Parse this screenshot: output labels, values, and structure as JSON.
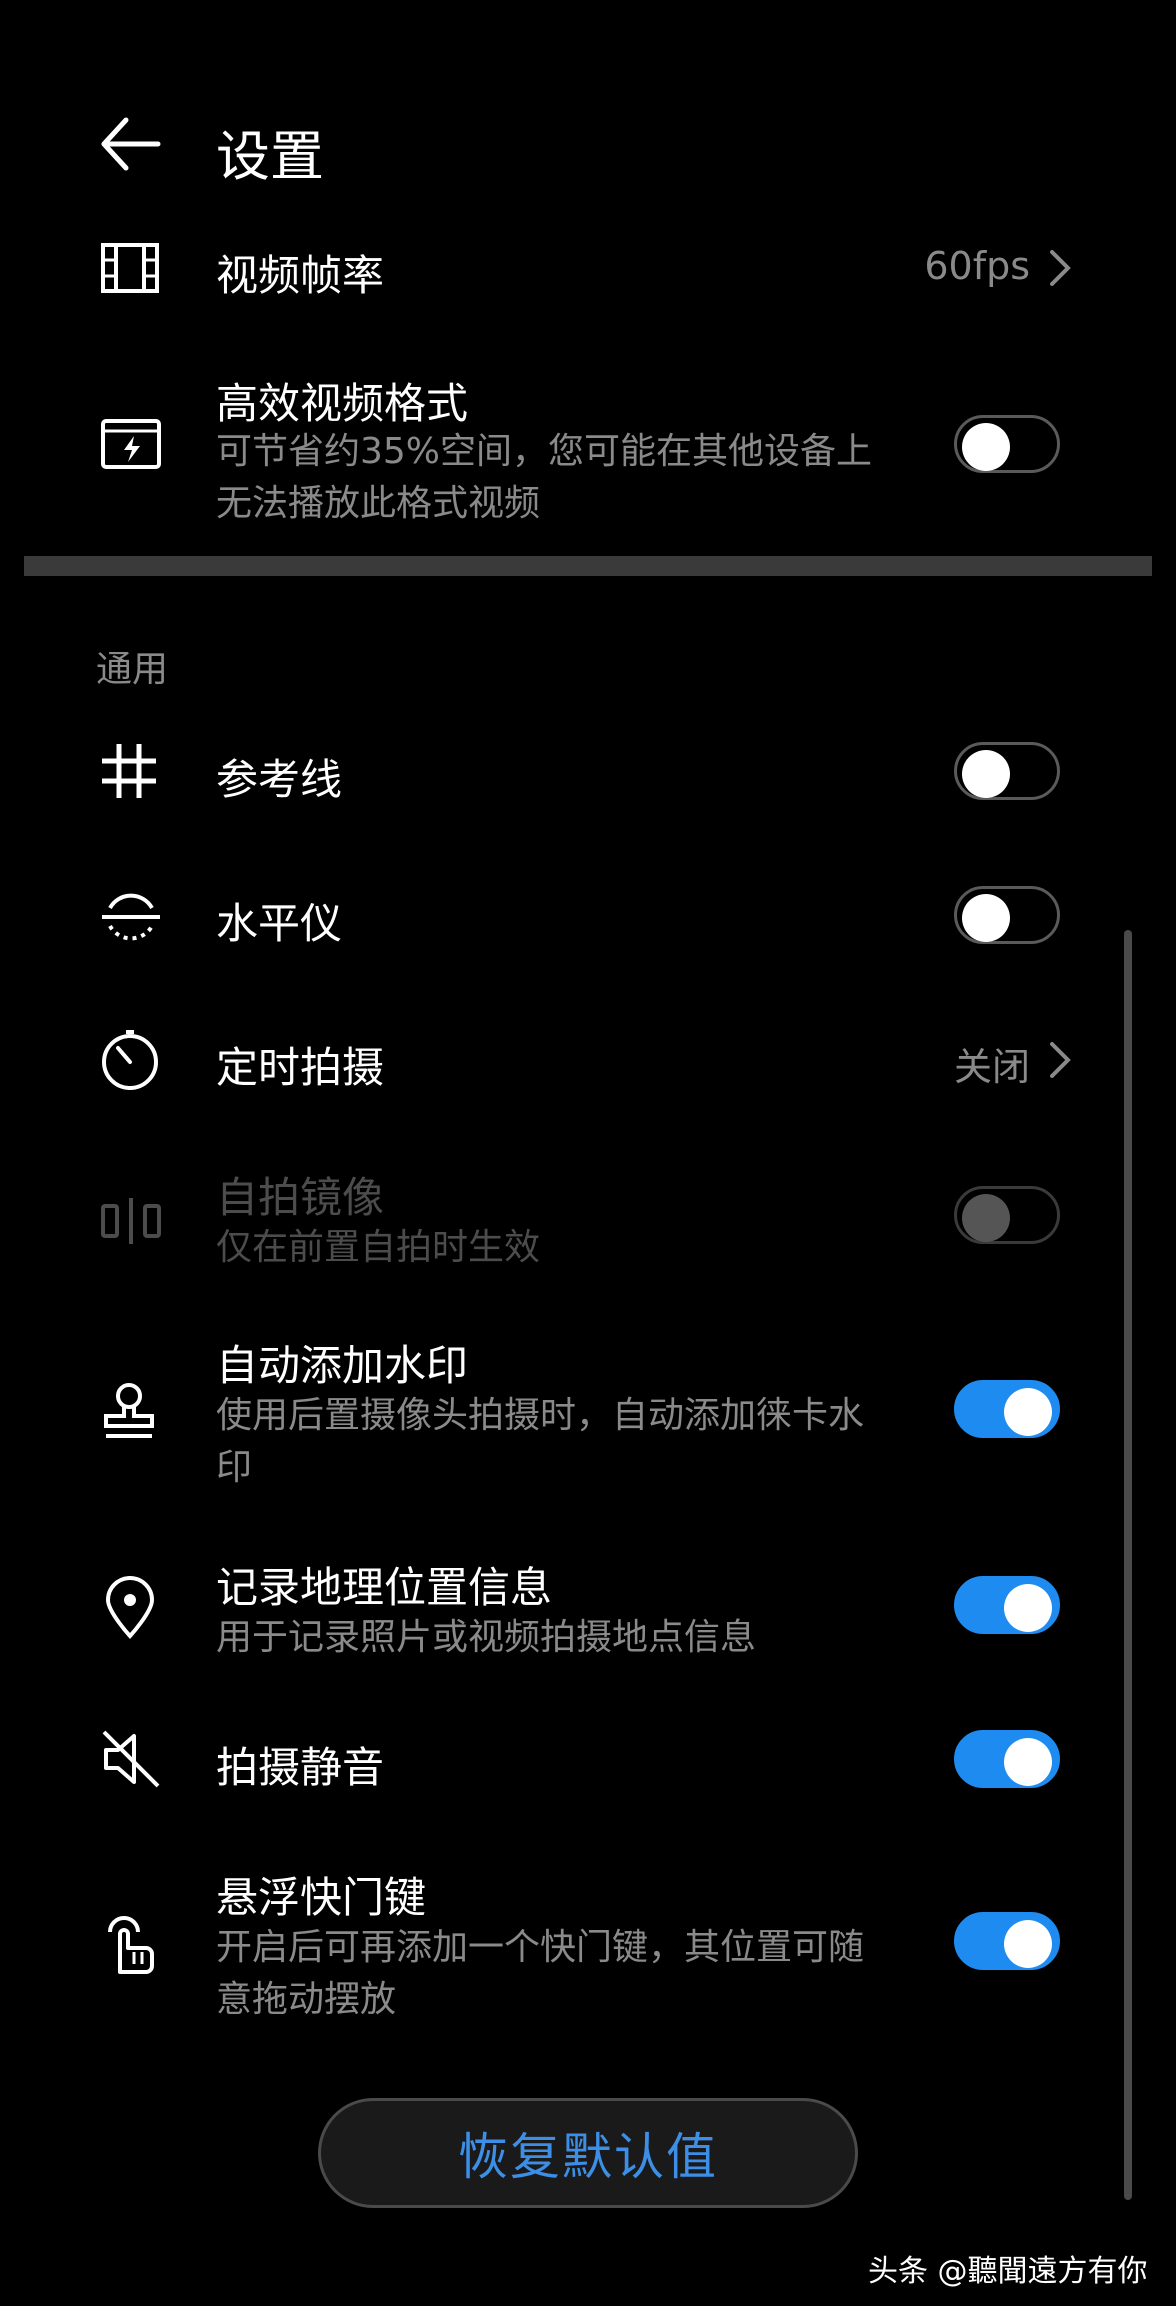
{
  "header": {
    "title": "设置"
  },
  "video_fps": {
    "label": "视频帧率",
    "value": "60fps"
  },
  "efficient_format": {
    "label": "高效视频格式",
    "subtitle": "可节省约35%空间，您可能在其他设备上无法播放此格式视频",
    "enabled": false
  },
  "section_general": {
    "label": "通用"
  },
  "grid": {
    "label": "参考线",
    "enabled": false
  },
  "level": {
    "label": "水平仪",
    "enabled": false
  },
  "timer": {
    "label": "定时拍摄",
    "value": "关闭"
  },
  "mirror": {
    "label": "自拍镜像",
    "subtitle": "仅在前置自拍时生效",
    "enabled": false,
    "disabled": true
  },
  "watermark": {
    "label": "自动添加水印",
    "subtitle": "使用后置摄像头拍摄时，自动添加徕卡水印",
    "enabled": true
  },
  "location": {
    "label": "记录地理位置信息",
    "subtitle": "用于记录照片或视频拍摄地点信息",
    "enabled": true
  },
  "mute": {
    "label": "拍摄静音",
    "enabled": true
  },
  "floating_shutter": {
    "label": "悬浮快门键",
    "subtitle": "开启后可再添加一个快门键，其位置可随意拖动摆放",
    "enabled": true
  },
  "reset_button": {
    "label": "恢复默认值"
  },
  "corner_watermark": {
    "text": "头条 @聽聞遠方有你"
  },
  "colors": {
    "accent": "#1e8bf0",
    "background": "#000000",
    "secondary_text": "#8a8a8a",
    "reset_text": "#3d8ee6"
  },
  "icons": [
    "back-arrow-icon",
    "film-icon",
    "hevc-icon",
    "grid-icon",
    "level-icon",
    "timer-icon",
    "mirror-icon",
    "stamp-icon",
    "location-pin-icon",
    "mute-icon",
    "touch-hand-icon",
    "chevron-right-icon"
  ]
}
